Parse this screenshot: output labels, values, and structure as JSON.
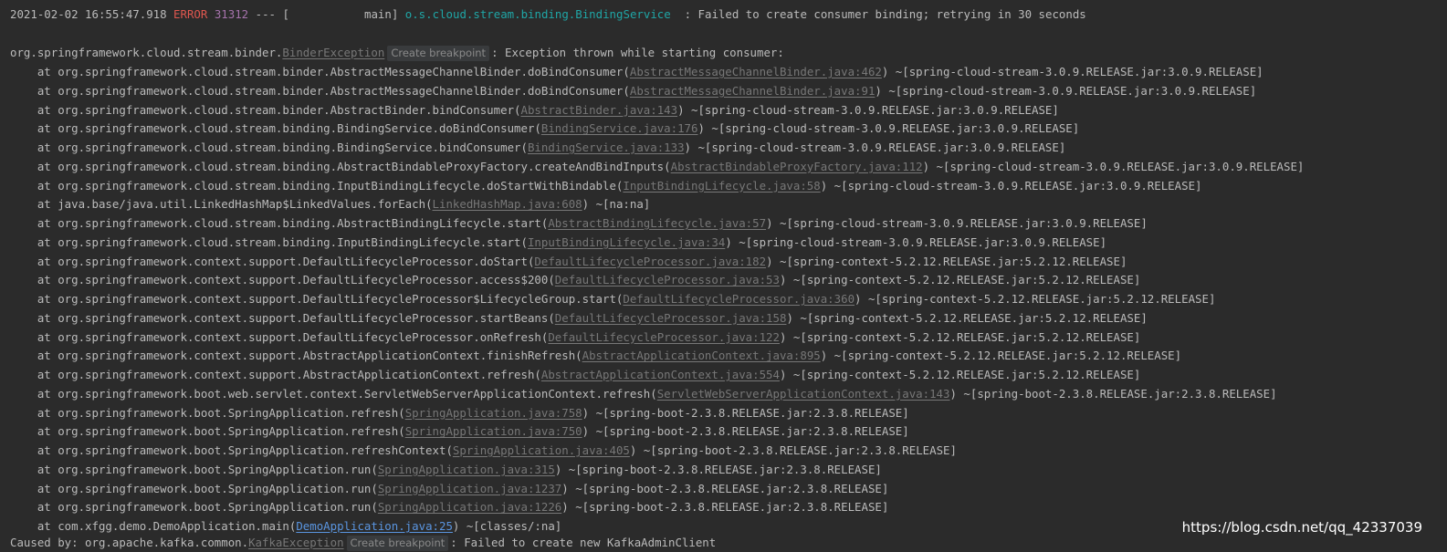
{
  "header": {
    "timestamp": "2021-02-02 16:55:47.918",
    "level": "ERROR",
    "pid": "31312",
    "sep": "---",
    "thread": "[           main]",
    "logger": "o.s.cloud.stream.binding.BindingService",
    "message": "  : Failed to create consumer binding; retrying in 30 seconds"
  },
  "exception": {
    "prefix": "org.springframework.cloud.stream.binder.",
    "class_link": "BinderException",
    "breakpoint_label": "Create breakpoint",
    "message": ": Exception thrown while starting consumer:"
  },
  "frames": [
    {
      "method": "org.springframework.cloud.stream.binder.AbstractMessageChannelBinder.doBindConsumer",
      "source": "AbstractMessageChannelBinder.java:462",
      "jar": "~[spring-cloud-stream-3.0.9.RELEASE.jar:3.0.9.RELEASE]"
    },
    {
      "method": "org.springframework.cloud.stream.binder.AbstractMessageChannelBinder.doBindConsumer",
      "source": "AbstractMessageChannelBinder.java:91",
      "jar": "~[spring-cloud-stream-3.0.9.RELEASE.jar:3.0.9.RELEASE]"
    },
    {
      "method": "org.springframework.cloud.stream.binder.AbstractBinder.bindConsumer",
      "source": "AbstractBinder.java:143",
      "jar": "~[spring-cloud-stream-3.0.9.RELEASE.jar:3.0.9.RELEASE]"
    },
    {
      "method": "org.springframework.cloud.stream.binding.BindingService.doBindConsumer",
      "source": "BindingService.java:176",
      "jar": "~[spring-cloud-stream-3.0.9.RELEASE.jar:3.0.9.RELEASE]"
    },
    {
      "method": "org.springframework.cloud.stream.binding.BindingService.bindConsumer",
      "source": "BindingService.java:133",
      "jar": "~[spring-cloud-stream-3.0.9.RELEASE.jar:3.0.9.RELEASE]"
    },
    {
      "method": "org.springframework.cloud.stream.binding.AbstractBindableProxyFactory.createAndBindInputs",
      "source": "AbstractBindableProxyFactory.java:112",
      "jar": "~[spring-cloud-stream-3.0.9.RELEASE.jar:3.0.9.RELEASE]"
    },
    {
      "method": "org.springframework.cloud.stream.binding.InputBindingLifecycle.doStartWithBindable",
      "source": "InputBindingLifecycle.java:58",
      "jar": "~[spring-cloud-stream-3.0.9.RELEASE.jar:3.0.9.RELEASE]"
    },
    {
      "method": "java.base/java.util.LinkedHashMap$LinkedValues.forEach",
      "source": "LinkedHashMap.java:608",
      "jar": "~[na:na]"
    },
    {
      "method": "org.springframework.cloud.stream.binding.AbstractBindingLifecycle.start",
      "source": "AbstractBindingLifecycle.java:57",
      "jar": "~[spring-cloud-stream-3.0.9.RELEASE.jar:3.0.9.RELEASE]"
    },
    {
      "method": "org.springframework.cloud.stream.binding.InputBindingLifecycle.start",
      "source": "InputBindingLifecycle.java:34",
      "jar": "~[spring-cloud-stream-3.0.9.RELEASE.jar:3.0.9.RELEASE]"
    },
    {
      "method": "org.springframework.context.support.DefaultLifecycleProcessor.doStart",
      "source": "DefaultLifecycleProcessor.java:182",
      "jar": "~[spring-context-5.2.12.RELEASE.jar:5.2.12.RELEASE]"
    },
    {
      "method": "org.springframework.context.support.DefaultLifecycleProcessor.access$200",
      "source": "DefaultLifecycleProcessor.java:53",
      "jar": "~[spring-context-5.2.12.RELEASE.jar:5.2.12.RELEASE]"
    },
    {
      "method": "org.springframework.context.support.DefaultLifecycleProcessor$LifecycleGroup.start",
      "source": "DefaultLifecycleProcessor.java:360",
      "jar": "~[spring-context-5.2.12.RELEASE.jar:5.2.12.RELEASE]"
    },
    {
      "method": "org.springframework.context.support.DefaultLifecycleProcessor.startBeans",
      "source": "DefaultLifecycleProcessor.java:158",
      "jar": "~[spring-context-5.2.12.RELEASE.jar:5.2.12.RELEASE]"
    },
    {
      "method": "org.springframework.context.support.DefaultLifecycleProcessor.onRefresh",
      "source": "DefaultLifecycleProcessor.java:122",
      "jar": "~[spring-context-5.2.12.RELEASE.jar:5.2.12.RELEASE]"
    },
    {
      "method": "org.springframework.context.support.AbstractApplicationContext.finishRefresh",
      "source": "AbstractApplicationContext.java:895",
      "jar": "~[spring-context-5.2.12.RELEASE.jar:5.2.12.RELEASE]"
    },
    {
      "method": "org.springframework.context.support.AbstractApplicationContext.refresh",
      "source": "AbstractApplicationContext.java:554",
      "jar": "~[spring-context-5.2.12.RELEASE.jar:5.2.12.RELEASE]"
    },
    {
      "method": "org.springframework.boot.web.servlet.context.ServletWebServerApplicationContext.refresh",
      "source": "ServletWebServerApplicationContext.java:143",
      "jar": "~[spring-boot-2.3.8.RELEASE.jar:2.3.8.RELEASE]"
    },
    {
      "method": "org.springframework.boot.SpringApplication.refresh",
      "source": "SpringApplication.java:758",
      "jar": "~[spring-boot-2.3.8.RELEASE.jar:2.3.8.RELEASE]"
    },
    {
      "method": "org.springframework.boot.SpringApplication.refresh",
      "source": "SpringApplication.java:750",
      "jar": "~[spring-boot-2.3.8.RELEASE.jar:2.3.8.RELEASE]"
    },
    {
      "method": "org.springframework.boot.SpringApplication.refreshContext",
      "source": "SpringApplication.java:405",
      "jar": "~[spring-boot-2.3.8.RELEASE.jar:2.3.8.RELEASE]"
    },
    {
      "method": "org.springframework.boot.SpringApplication.run",
      "source": "SpringApplication.java:315",
      "jar": "~[spring-boot-2.3.8.RELEASE.jar:2.3.8.RELEASE]"
    },
    {
      "method": "org.springframework.boot.SpringApplication.run",
      "source": "SpringApplication.java:1237",
      "jar": "~[spring-boot-2.3.8.RELEASE.jar:2.3.8.RELEASE]"
    },
    {
      "method": "org.springframework.boot.SpringApplication.run",
      "source": "SpringApplication.java:1226",
      "jar": "~[spring-boot-2.3.8.RELEASE.jar:2.3.8.RELEASE]"
    },
    {
      "method": "com.xfgg.demo.DemoApplication.main",
      "source": "DemoApplication.java:25",
      "jar": "~[classes/:na]",
      "user_code": true
    }
  ],
  "caused_by": {
    "prefix": "Caused by: org.apache.kafka.common.",
    "class_link": "KafkaException",
    "breakpoint_label": "Create breakpoint",
    "message": ": Failed to create new KafkaAdminClient"
  },
  "watermark": "https://blog.csdn.net/qq_42337039",
  "colors": {
    "background": "#2b2b2b",
    "text": "#bbbbbb",
    "error": "#e0574f",
    "pid": "#a673ac",
    "logger": "#1fa6a6",
    "link": "#777777",
    "user_link": "#5a95e0"
  }
}
